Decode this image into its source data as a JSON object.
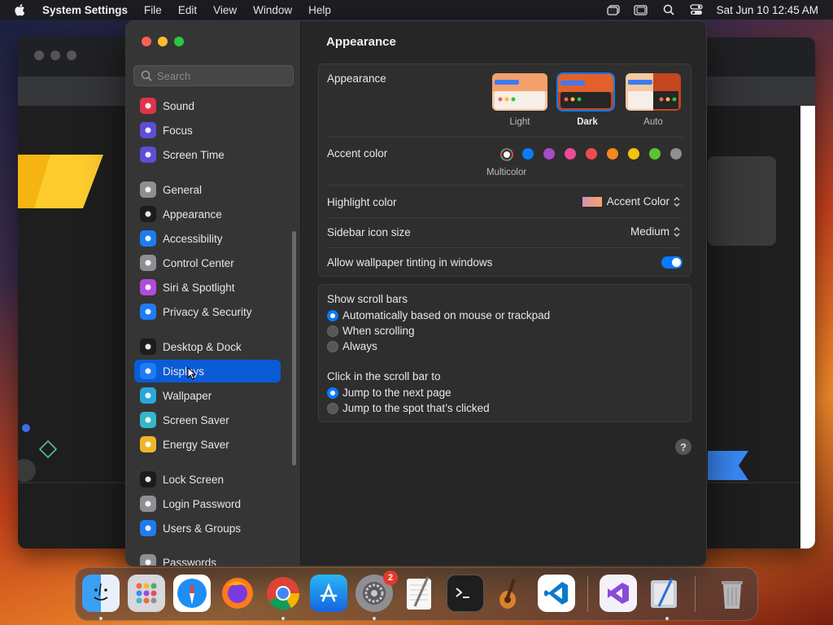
{
  "menubar": {
    "app_name": "System Settings",
    "menus": [
      "File",
      "Edit",
      "View",
      "Window",
      "Help"
    ],
    "datetime": "Sat Jun 10  12:45 AM"
  },
  "search": {
    "placeholder": "Search"
  },
  "sidebar": {
    "items": [
      {
        "label": "Sound",
        "icon": "sound-icon",
        "color": "#e0334b"
      },
      {
        "label": "Focus",
        "icon": "moon-icon",
        "color": "#5b4fd8"
      },
      {
        "label": "Screen Time",
        "icon": "hourglass-icon",
        "color": "#5b4fd8"
      },
      {
        "label": "General",
        "icon": "gear-icon",
        "color": "#8e8e93"
      },
      {
        "label": "Appearance",
        "icon": "appearance-icon",
        "color": "#1c1c1e"
      },
      {
        "label": "Accessibility",
        "icon": "accessibility-icon",
        "color": "#1e7cf2"
      },
      {
        "label": "Control Center",
        "icon": "control-center-icon",
        "color": "#8e8e93"
      },
      {
        "label": "Siri & Spotlight",
        "icon": "siri-icon",
        "color": "#b34ad9"
      },
      {
        "label": "Privacy & Security",
        "icon": "hand-icon",
        "color": "#1e7cf2"
      },
      {
        "label": "Desktop & Dock",
        "icon": "dock-icon",
        "color": "#1c1c1e"
      },
      {
        "label": "Displays",
        "icon": "sun-icon",
        "color": "#1e7cf2"
      },
      {
        "label": "Wallpaper",
        "icon": "wallpaper-icon",
        "color": "#2aa7d9"
      },
      {
        "label": "Screen Saver",
        "icon": "screen-saver-icon",
        "color": "#35b7c9"
      },
      {
        "label": "Energy Saver",
        "icon": "bulb-icon",
        "color": "#f0b429"
      },
      {
        "label": "Lock Screen",
        "icon": "lock-icon",
        "color": "#1c1c1e"
      },
      {
        "label": "Login Password",
        "icon": "password-icon",
        "color": "#8e8e93"
      },
      {
        "label": "Users & Groups",
        "icon": "users-icon",
        "color": "#1e7cf2"
      },
      {
        "label": "Passwords",
        "icon": "key-icon",
        "color": "#8e8e93"
      }
    ],
    "selected": "Displays"
  },
  "main": {
    "title": "Appearance",
    "appearance": {
      "label": "Appearance",
      "options": [
        "Light",
        "Dark",
        "Auto"
      ],
      "selected": "Dark"
    },
    "accent": {
      "label": "Accent color",
      "caption": "Multicolor",
      "colors": [
        "#0a7aff",
        "#a54cc7",
        "#ea4c9a",
        "#f04b4b",
        "#f7891b",
        "#f5c20b",
        "#5bc236",
        "#8e8e93"
      ]
    },
    "highlight": {
      "label": "Highlight color",
      "value": "Accent Color"
    },
    "sidebar_icon_size": {
      "label": "Sidebar icon size",
      "value": "Medium"
    },
    "wallpaper_tinting": {
      "label": "Allow wallpaper tinting in windows",
      "on": true
    },
    "scroll_bars": {
      "label": "Show scroll bars",
      "options": [
        "Automatically based on mouse or trackpad",
        "When scrolling",
        "Always"
      ],
      "selected": 0
    },
    "click_scroll": {
      "label": "Click in the scroll bar to",
      "options": [
        "Jump to the next page",
        "Jump to the spot that’s clicked"
      ],
      "selected": 0
    },
    "help": "?"
  },
  "dock": {
    "apps": [
      "Finder",
      "Launchpad",
      "Safari",
      "Firefox",
      "Chrome",
      "App Store",
      "System Settings",
      "TextEdit",
      "Terminal",
      "GarageBand",
      "VS Code",
      "Visual Studio",
      "Script Editor",
      "Trash"
    ],
    "settings_badge": "2"
  }
}
